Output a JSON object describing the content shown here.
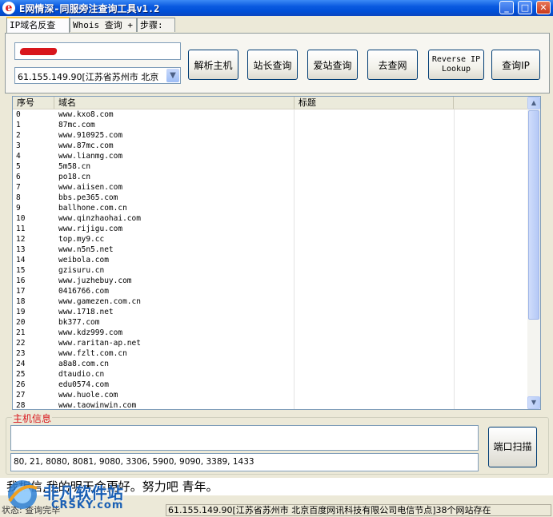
{
  "window": {
    "title": "E网情深-同服旁注查询工具v1.2",
    "app_icon": "e"
  },
  "window_controls": {
    "minimize": "_",
    "maximize": "□",
    "close": "✕"
  },
  "tabs": [
    {
      "label": "IP域名反查"
    },
    {
      "label": "Whois 查询 +"
    },
    {
      "label": "步骤:"
    }
  ],
  "host_input": {
    "value": ""
  },
  "ip_select": {
    "value": "61.155.149.90[江苏省苏州市 北京"
  },
  "buttons": {
    "resolve": "解析主机",
    "chinaz": "站长查询",
    "aizhan": "爱站查询",
    "chawang": "去查网",
    "reverse_line1": "Reverse IP",
    "reverse_line2": "Lookup",
    "query_ip": "查询IP"
  },
  "list": {
    "columns": [
      "序号",
      "域名",
      "标题"
    ],
    "rows": [
      [
        "0",
        "www.kxo8.com",
        ""
      ],
      [
        "1",
        "87mc.com",
        ""
      ],
      [
        "2",
        "www.910925.com",
        ""
      ],
      [
        "3",
        "www.87mc.com",
        ""
      ],
      [
        "4",
        "www.lianmg.com",
        ""
      ],
      [
        "5",
        "5m58.cn",
        ""
      ],
      [
        "6",
        "po18.cn",
        ""
      ],
      [
        "7",
        "www.aiisen.com",
        ""
      ],
      [
        "8",
        "bbs.pe365.com",
        ""
      ],
      [
        "9",
        "ballhone.com.cn",
        ""
      ],
      [
        "10",
        "www.qinzhaohai.com",
        ""
      ],
      [
        "11",
        "www.rijigu.com",
        ""
      ],
      [
        "12",
        "top.my9.cc",
        ""
      ],
      [
        "13",
        "www.n5n5.net",
        ""
      ],
      [
        "14",
        "weibola.com",
        ""
      ],
      [
        "15",
        "gzisuru.cn",
        ""
      ],
      [
        "16",
        "www.juzhebuy.com",
        ""
      ],
      [
        "17",
        "0416766.com",
        ""
      ],
      [
        "18",
        "www.gamezen.com.cn",
        ""
      ],
      [
        "19",
        "www.1718.net",
        ""
      ],
      [
        "20",
        "bk377.com",
        ""
      ],
      [
        "21",
        "www.kdz999.com",
        ""
      ],
      [
        "22",
        "www.raritan-ap.net",
        ""
      ],
      [
        "23",
        "www.fzlt.com.cn",
        ""
      ],
      [
        "24",
        "a8a8.com.cn",
        ""
      ],
      [
        "25",
        "dtaudio.cn",
        ""
      ],
      [
        "26",
        "edu0574.com",
        ""
      ],
      [
        "27",
        "www.huole.com",
        ""
      ],
      [
        "28",
        "www.taowinwin.com",
        ""
      ]
    ]
  },
  "host_info": {
    "label": "主机信息",
    "details": "",
    "ports": "80, 21, 8080, 8081, 9080, 3306, 5900, 9090, 3389, 1433",
    "scan_button": "端口扫描"
  },
  "motto": "我相信,我的明天会更好。努力吧 青年。",
  "status": {
    "left": "状态: 查询完毕",
    "right": "61.155.149.90[江苏省苏州市 北京百度网讯科技有限公司电信节点]38个网站存在"
  },
  "watermark": {
    "text": "非凡软件站",
    "sub": "CRSKY.com"
  },
  "colors": {
    "titlebar": "#0a5ae0",
    "accent_red": "#d8161c",
    "window_bg": "#ece9d8"
  }
}
